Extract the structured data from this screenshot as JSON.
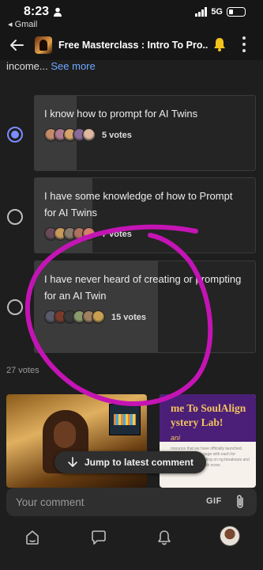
{
  "status_bar": {
    "time": "8:23",
    "back_label": "◂ Gmail",
    "network": "5G"
  },
  "header": {
    "title": "Free Masterclass : Intro To Pro..."
  },
  "post": {
    "truncated_text": "income...",
    "see_more": "See more"
  },
  "poll": {
    "options": [
      {
        "text": "I know how to prompt for AI Twins",
        "votes_label": "5 votes",
        "votes": 5,
        "selected": true,
        "avatar_colors": [
          "#c58a6a",
          "#b07a90",
          "#d7a36a",
          "#8a6a9a",
          "#e0b8a0"
        ]
      },
      {
        "text": "I have some knowledge of how to Prompt for AI Twins",
        "votes_label": "7 votes",
        "votes": 7,
        "selected": false,
        "avatar_colors": [
          "#6a4a5a",
          "#c89a5a",
          "#8a7a6a",
          "#b07060",
          "#d4806a"
        ]
      },
      {
        "text": "I have never heard of creating or prompting for an AI Twin",
        "votes_label": "15 votes",
        "votes": 15,
        "selected": false,
        "avatar_colors": [
          "#5a5a6a",
          "#7a3a2a",
          "#3a3a3a",
          "#8a9a6a",
          "#a08060",
          "#c8a050"
        ]
      }
    ],
    "total_votes": 27,
    "total_label": "27 votes"
  },
  "media": {
    "card_b_line1": "me To SoulAlign",
    "card_b_line2": "ystery Lab!",
    "card_b_name": "ani",
    "card_b_fine": "nnounce that we have officially launched, weekly interaction gage with each for beginners in Depending on ng breakouts and workgroups, wontgrob ncres"
  },
  "jump": {
    "label": "Jump to latest comment"
  },
  "composer": {
    "placeholder": "Your comment",
    "gif_label": "GIF"
  },
  "annotation": {
    "color": "#c414b4"
  }
}
